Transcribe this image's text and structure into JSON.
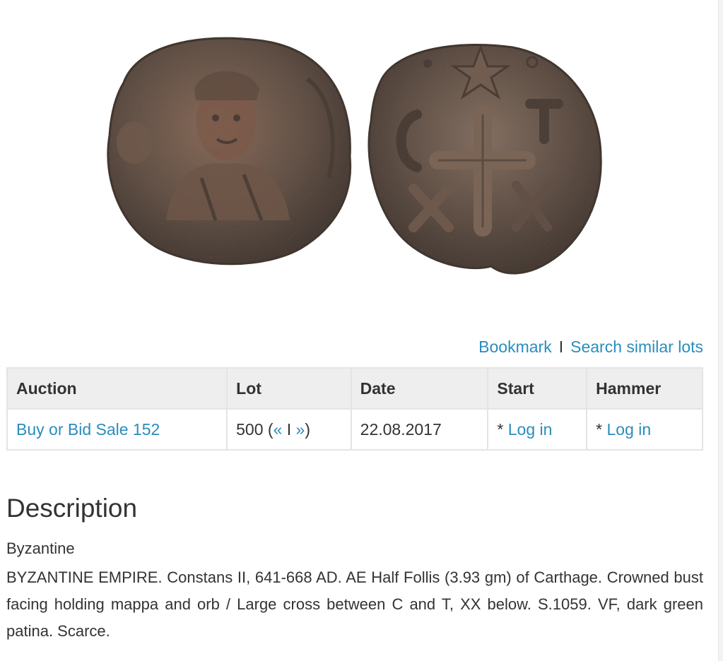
{
  "image": {
    "alt": "Byzantine coin obverse and reverse",
    "obverse_icon": "coin-obverse-bust",
    "reverse_icon": "coin-reverse-cross"
  },
  "actions": {
    "bookmark": "Bookmark",
    "separator": "I",
    "search_similar": "Search similar lots"
  },
  "table": {
    "headers": [
      "Auction",
      "Lot",
      "Date",
      "Start",
      "Hammer"
    ],
    "row": {
      "auction": "Buy or Bid Sale 152",
      "lot_number": "500 (",
      "lot_prev": "«",
      "lot_sep": " I ",
      "lot_next": "»",
      "lot_close": ")",
      "date": "22.08.2017",
      "start_prefix": "* ",
      "start_link": "Log in",
      "hammer_prefix": "* ",
      "hammer_link": "Log in"
    }
  },
  "description": {
    "heading": "Description",
    "category": "Byzantine",
    "text": "BYZANTINE EMPIRE. Constans II, 641-668 AD. AE Half Follis (3.93 gm) of Carthage. Crowned bust facing holding mappa and orb / Large cross between C and T, XX below. S.1059. VF, dark green patina. Scarce."
  },
  "colors": {
    "link": "#2a8dbd",
    "text": "#333333",
    "header_bg": "#eeeeee",
    "border": "#e4e4e4",
    "coin_dark": "#4a3f36",
    "coin_mid": "#6e5a4c",
    "coin_copper": "#8a5a45"
  }
}
